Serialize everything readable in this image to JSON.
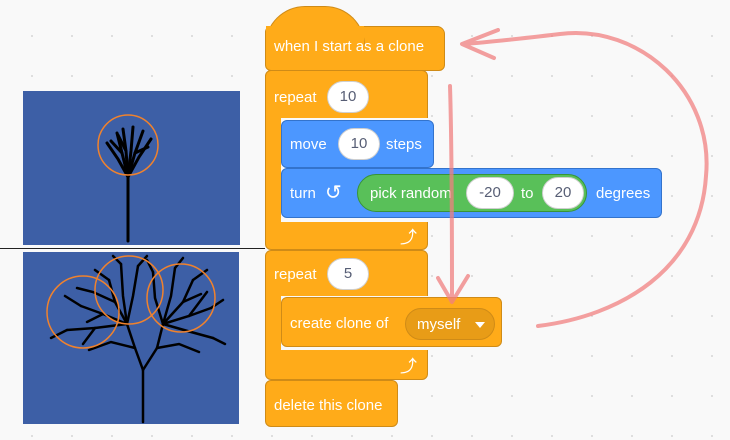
{
  "script_blocks": {
    "hat": {
      "label": "when I start as a clone"
    },
    "repeat_1": {
      "label": "repeat",
      "count": "10"
    },
    "move": {
      "label": "move",
      "value": "10",
      "suffix": "steps"
    },
    "turn": {
      "label": "turn",
      "suffix": "degrees",
      "icon": "rotate-left-icon"
    },
    "pick_random": {
      "label": "pick random",
      "from": "-20",
      "to_label": "to",
      "to": "20"
    },
    "repeat_2": {
      "label": "repeat",
      "count": "5"
    },
    "create_clone": {
      "label": "create clone of",
      "target": "myself"
    },
    "delete_clone": {
      "label": "delete this clone"
    }
  },
  "colors": {
    "control": "#ffab19",
    "motion": "#4c97ff",
    "operator": "#59c059",
    "stage_bg": "#3d5fa6",
    "annotation": "#f08080"
  }
}
